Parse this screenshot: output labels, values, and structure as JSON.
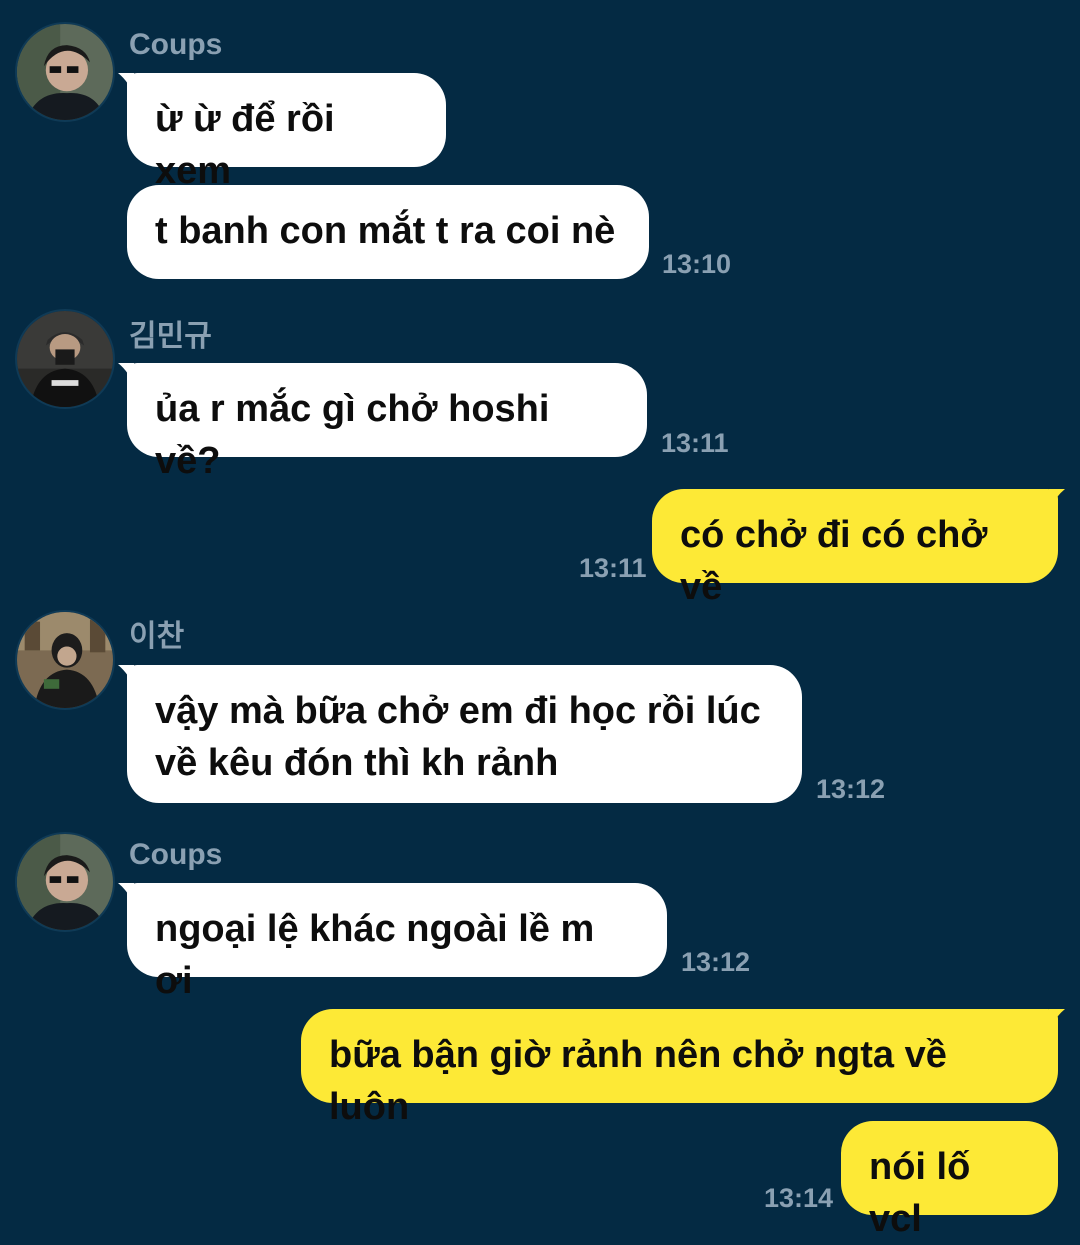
{
  "messages": [
    {
      "sender": "Coups",
      "text": "ừ ừ để rồi xem"
    },
    {
      "text": "t banh con mắt t ra coi nè",
      "time": "13:10"
    },
    {
      "sender": "김민규",
      "text": "ủa r mắc gì chở hoshi về?",
      "time": "13:11"
    },
    {
      "text": "có chở đi có chở về",
      "time": "13:11"
    },
    {
      "sender": "이찬",
      "text_line1": "vậy mà bữa chở em đi học rồi lúc",
      "text_line2": "về kêu đón thì kh rảnh",
      "time": "13:12"
    },
    {
      "sender": "Coups",
      "text": "ngoại lệ khác ngoài lề m ơi",
      "time": "13:12"
    },
    {
      "text": "bữa bận giờ rảnh nên chở ngta về luôn"
    },
    {
      "text": "nói lố vcl",
      "time": "13:14"
    }
  ],
  "colors": {
    "background": "#042A43",
    "incoming_bubble": "#FFFFFF",
    "outgoing_bubble": "#FDE936",
    "meta_text": "#8AA0B2"
  }
}
